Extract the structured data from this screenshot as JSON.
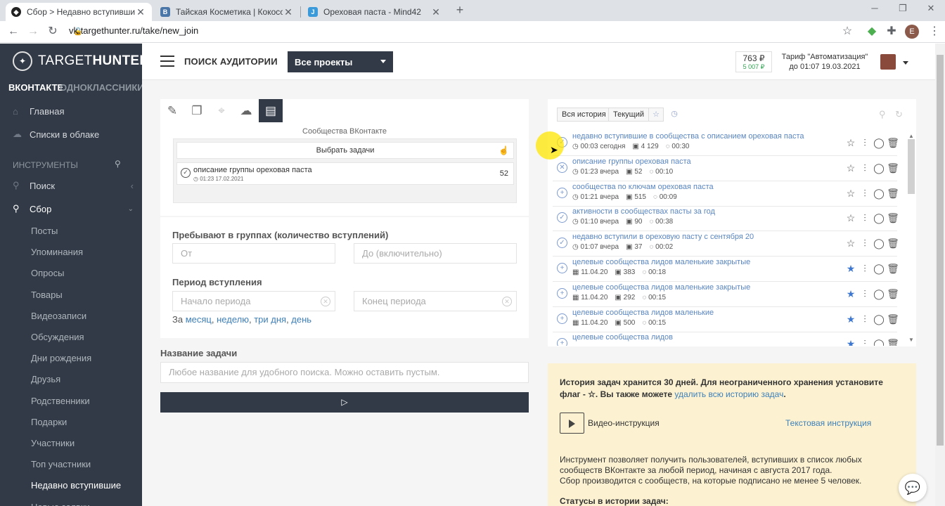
{
  "browser": {
    "tabs": [
      {
        "title": "Сбор > Недавно вступившие – ",
        "favicon": "targethunter-icon"
      },
      {
        "title": "Тайская Косметика | Кокосовое",
        "favicon": "vk-icon"
      },
      {
        "title": "Ореховая паста - Mind42",
        "favicon": "mind42-icon"
      }
    ],
    "new_tab": "+",
    "url": "vk.targethunter.ru/take/new_join",
    "profile_initial": "E"
  },
  "sidebar": {
    "logo_light": "TARGET",
    "logo_bold": "HUNTER",
    "networks": {
      "vk": "ВКОНТАКТЕ",
      "ok": "ОДНОКЛАССНИКИ"
    },
    "top_items": [
      {
        "label": "Главная",
        "icon": "home-icon"
      },
      {
        "label": "Списки в облаке",
        "icon": "cloud-icon"
      }
    ],
    "tools_header": "ИНСТРУМЕНТЫ",
    "search_item": "Поиск",
    "collect_item": "Сбор",
    "sub_items": [
      "Посты",
      "Упоминания",
      "Опросы",
      "Товары",
      "Видеозаписи",
      "Обсуждения",
      "Дни рождения",
      "Друзья",
      "Родственники",
      "Подарки",
      "Участники",
      "Топ участники",
      "Недавно вступившие",
      "Новые заявки"
    ],
    "active_sub": "Недавно вступившие"
  },
  "header": {
    "title": "ПОИСК АУДИТОРИИ",
    "project_select": "Все проекты",
    "balance_main": "763 ₽",
    "balance_bonus": "5 007 ₽",
    "tarif_line1": "Тариф \"Автоматизация\"",
    "tarif_line2": "до 01:07 19.03.2021"
  },
  "form": {
    "toolbar_icons": [
      "edit-icon",
      "copy-icon",
      "location-icon",
      "upload-icon",
      "book-icon"
    ],
    "communities_title": "Сообщества ВКонтакте",
    "choose_tasks": "Выбрать задачи",
    "selected_task": {
      "name": "описание группы ореховая паста",
      "datetime": "01:23 17.02.2021",
      "count": "52"
    },
    "groups_label": "Пребывают в группах (количество вступлений)",
    "from_placeholder": "От",
    "to_placeholder": "До (включительно)",
    "period_label": "Период вступления",
    "period_start_placeholder": "Начало периода",
    "period_end_placeholder": "Конец периода",
    "period_prefix": "За",
    "period_links": [
      "месяц",
      "неделю",
      "три дня",
      "день"
    ],
    "task_name_label": "Название задачи",
    "task_name_placeholder": "Любое название для удобного поиска. Можно оставить пустым.",
    "run_icon": "play-icon"
  },
  "history": {
    "tabs": [
      "Вся история",
      "Текущий"
    ],
    "rows": [
      {
        "title": "недавно вступившие в сообщества с описанием ореховая паста",
        "time": "00:03 сегодня",
        "count": "4 129",
        "duration": "00:30",
        "status": "check",
        "starred": false,
        "date_icon": "clock-icon"
      },
      {
        "title": "описание группы ореховая паста",
        "time": "01:23 вчера",
        "count": "52",
        "duration": "00:10",
        "status": "cross",
        "starred": false,
        "date_icon": "clock-icon"
      },
      {
        "title": "сообщества по ключам ореховая паста",
        "time": "01:21 вчера",
        "count": "515",
        "duration": "00:09",
        "status": "plus",
        "starred": false,
        "date_icon": "clock-icon"
      },
      {
        "title": "активности в сообществах пасты за год",
        "time": "01:10 вчера",
        "count": "90",
        "duration": "00:38",
        "status": "check",
        "starred": false,
        "date_icon": "clock-icon"
      },
      {
        "title": "недавно вступили в ореховую пасту с сентября 20",
        "time": "01:07 вчера",
        "count": "37",
        "duration": "00:02",
        "status": "check",
        "starred": false,
        "date_icon": "clock-icon"
      },
      {
        "title": "целевые сообщества лидов маленькие закрытые",
        "time": "11.04.20",
        "count": "383",
        "duration": "00:18",
        "status": "plus",
        "starred": true,
        "date_icon": "calendar-icon"
      },
      {
        "title": "целевые сообщества лидов маленькие закрытые",
        "time": "11.04.20",
        "count": "292",
        "duration": "00:15",
        "status": "plus",
        "starred": true,
        "date_icon": "calendar-icon"
      },
      {
        "title": "целевые сообщества лидов маленькие",
        "time": "11.04.20",
        "count": "500",
        "duration": "00:15",
        "status": "plus",
        "starred": true,
        "date_icon": "calendar-icon"
      },
      {
        "title": "целевые сообщества лидов",
        "time": "",
        "count": "",
        "duration": "",
        "status": "plus",
        "starred": true,
        "date_icon": "calendar-icon"
      }
    ]
  },
  "info": {
    "retention_text": "История задач хранится 30 дней. Для неограниченного хранения установите флаг - ☆. Вы также можете",
    "delete_link": "удалить всю историю задач",
    "video_label": "Видео-инструкция",
    "text_instr_link": "Текстовая инструкция",
    "desc_line1": "Инструмент позволяет получить пользователей, вступивших в список любых сообществ ВКонтакте за любой период, начиная с августа 2017 года.",
    "desc_line2": "Сбор производится с сообществ, на которые подписано не менее 5 человек.",
    "statuses_heading": "Статусы в истории задач:"
  }
}
